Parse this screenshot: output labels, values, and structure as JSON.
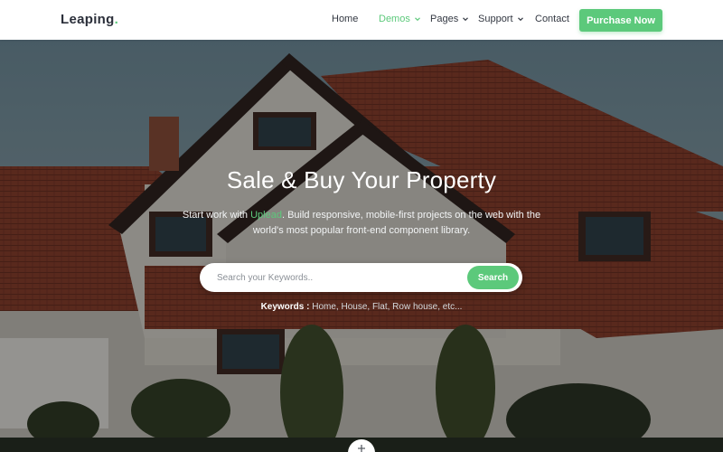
{
  "nav": {
    "logo": "Leaping",
    "logo_dot": ".",
    "items": [
      {
        "label": "Home",
        "has_dropdown": false,
        "active": false
      },
      {
        "label": "Demos",
        "has_dropdown": true,
        "active": true
      },
      {
        "label": "Pages",
        "has_dropdown": true,
        "active": false
      },
      {
        "label": "Support",
        "has_dropdown": true,
        "active": false
      },
      {
        "label": "Contact",
        "has_dropdown": false,
        "active": false
      }
    ],
    "cta": "Purchase Now"
  },
  "hero": {
    "title": "Sale & Buy Your Property",
    "desc_pre": "Start work with ",
    "desc_highlight": "Uplead",
    "desc_post": ". Build responsive, mobile-first projects on the web with the world's most popular front-end component library.",
    "search": {
      "placeholder": "Search your Keywords..",
      "button": "Search"
    },
    "keywords_label": "Keywords :",
    "keywords": " Home, House, Flat, Row house, etc..."
  },
  "scroll_icon": "plus-icon",
  "colors": {
    "accent": "#5cc97b",
    "text_dark": "#2b2f3a",
    "nav_bg": "#ffffff"
  }
}
